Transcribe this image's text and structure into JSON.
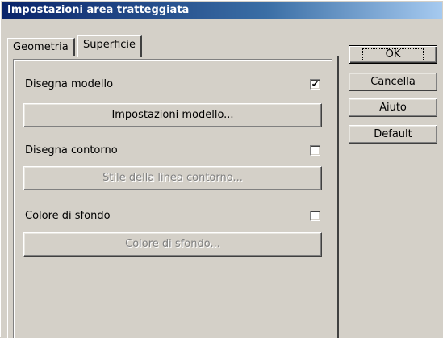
{
  "window": {
    "title": "Impostazioni area tratteggiata"
  },
  "tabs": [
    {
      "label": "Geometria",
      "active": false
    },
    {
      "label": "Superficie",
      "active": true
    }
  ],
  "surface": {
    "draw_pattern": {
      "label": "Disegna modello",
      "checked": true
    },
    "pattern_settings_button": {
      "label": "Impostazioni modello...",
      "enabled": true
    },
    "draw_outline": {
      "label": "Disegna contorno",
      "checked": false
    },
    "outline_style_button": {
      "label": "Stile della linea contorno...",
      "enabled": false
    },
    "background_color": {
      "label": "Colore di sfondo",
      "checked": false
    },
    "background_color_button": {
      "label": "Colore di sfondo...",
      "enabled": false
    }
  },
  "buttons": {
    "ok": "OK",
    "cancel": "Cancella",
    "help": "Aiuto",
    "default": "Default"
  },
  "colors": {
    "face": "#d4d0c8",
    "title_start": "#0a246a",
    "title_end": "#a6caf0",
    "disabled_text": "#808080"
  }
}
